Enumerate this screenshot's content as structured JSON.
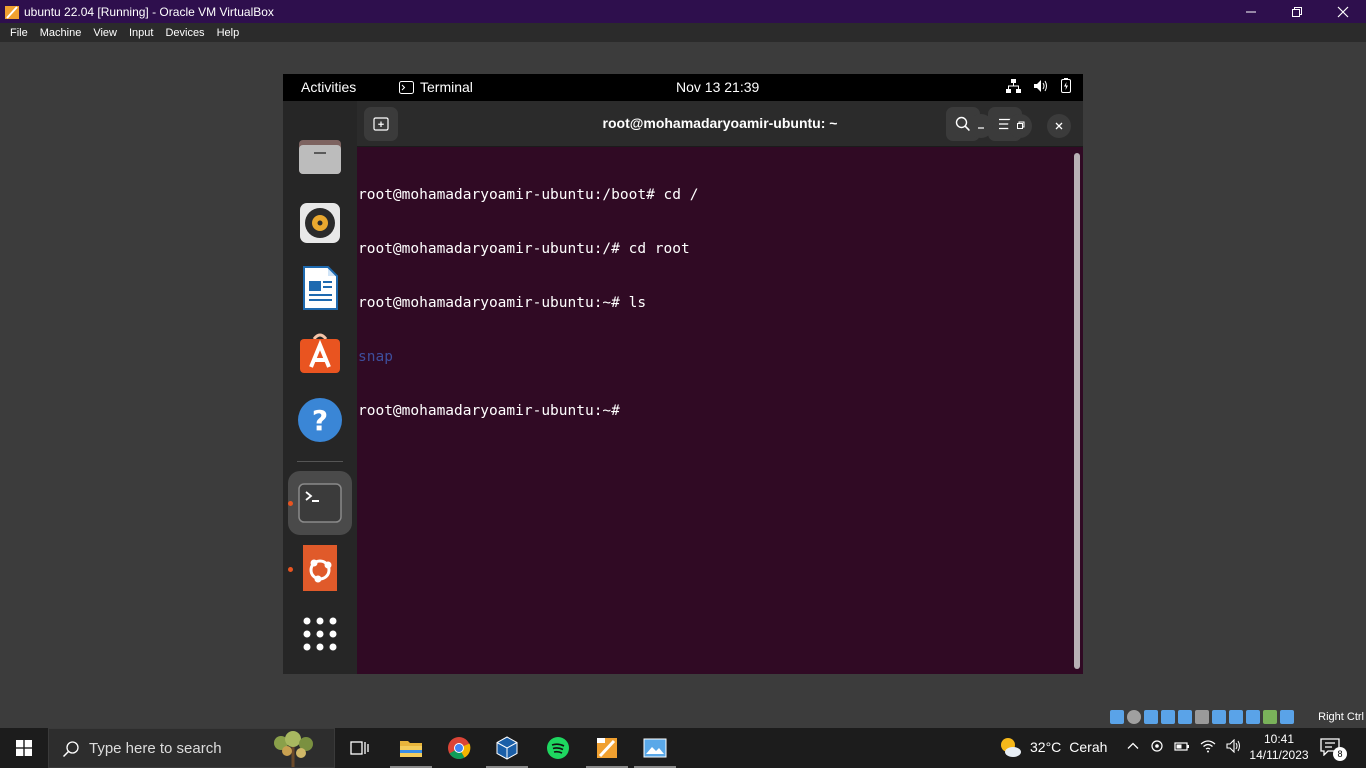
{
  "vbox": {
    "title": "ubuntu 22.04 [Running] - Oracle VM VirtualBox",
    "menu": [
      "File",
      "Machine",
      "View",
      "Input",
      "Devices",
      "Help"
    ],
    "host_key": "Right Ctrl"
  },
  "gnome": {
    "activities": "Activities",
    "app_name": "Terminal",
    "clock": "Nov 13  21:39"
  },
  "dock": {
    "items": [
      "files",
      "rhythmbox",
      "libreoffice-writer",
      "ubuntu-software",
      "help",
      "terminal",
      "ubuntu-installer",
      "show-apps"
    ]
  },
  "terminal": {
    "title": "root@mohamadaryoamir-ubuntu: ~",
    "lines": [
      "root@mohamadaryoamir-ubuntu:/boot# cd /",
      "root@mohamadaryoamir-ubuntu:/# cd root",
      "root@mohamadaryoamir-ubuntu:~# ls",
      "snap",
      "root@mohamadaryoamir-ubuntu:~#"
    ]
  },
  "taskbar": {
    "search_placeholder": "Type here to search",
    "weather_temp": "32°C",
    "weather_desc": "Cerah",
    "time": "10:41",
    "date": "14/11/2023",
    "notification_count": "8"
  },
  "colors": {
    "terminal_bg": "#300a24",
    "accent": "#e95420",
    "vbox_titlebar": "#2e0f4d"
  }
}
